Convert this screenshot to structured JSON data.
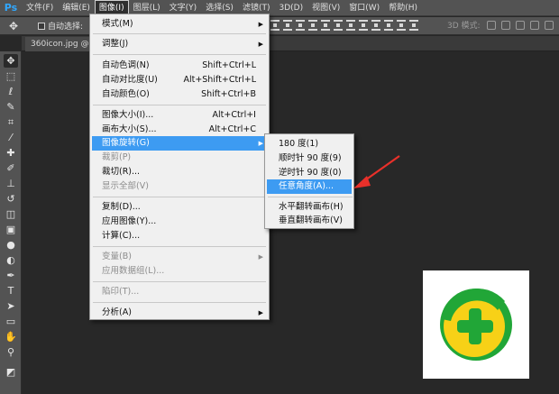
{
  "app": {
    "logo": "Ps"
  },
  "menubar": {
    "items": [
      {
        "label": "文件(F)"
      },
      {
        "label": "编辑(E)"
      },
      {
        "label": "图像(I)"
      },
      {
        "label": "图层(L)"
      },
      {
        "label": "文字(Y)"
      },
      {
        "label": "选择(S)"
      },
      {
        "label": "滤镜(T)"
      },
      {
        "label": "3D(D)"
      },
      {
        "label": "视图(V)"
      },
      {
        "label": "窗口(W)"
      },
      {
        "label": "帮助(H)"
      }
    ],
    "active_index": 2
  },
  "options_bar": {
    "auto_select_label": "自动选择:",
    "mode_3d_label": "3D 模式:"
  },
  "document": {
    "tab_label": "360icon.jpg @ 10"
  },
  "image_menu": {
    "items": [
      {
        "label": "模式(M)",
        "submenu": true
      },
      {
        "label": "调整(J)",
        "submenu": true
      },
      {
        "label": "自动色调(N)",
        "shortcut": "Shift+Ctrl+L"
      },
      {
        "label": "自动对比度(U)",
        "shortcut": "Alt+Shift+Ctrl+L"
      },
      {
        "label": "自动颜色(O)",
        "shortcut": "Shift+Ctrl+B"
      },
      {
        "label": "图像大小(I)...",
        "shortcut": "Alt+Ctrl+I"
      },
      {
        "label": "画布大小(S)...",
        "shortcut": "Alt+Ctrl+C"
      },
      {
        "label": "图像旋转(G)",
        "submenu": true,
        "highlighted": true
      },
      {
        "label": "裁剪(P)",
        "disabled": true
      },
      {
        "label": "裁切(R)..."
      },
      {
        "label": "显示全部(V)",
        "disabled": true
      },
      {
        "label": "复制(D)..."
      },
      {
        "label": "应用图像(Y)..."
      },
      {
        "label": "计算(C)..."
      },
      {
        "label": "变量(B)",
        "submenu": true,
        "disabled": true
      },
      {
        "label": "应用数据组(L)...",
        "disabled": true
      },
      {
        "label": "陷印(T)...",
        "disabled": true
      },
      {
        "label": "分析(A)",
        "submenu": true
      }
    ]
  },
  "rotate_submenu": {
    "items": [
      {
        "label": "180 度(1)"
      },
      {
        "label": "顺时针 90 度(9)"
      },
      {
        "label": "逆时针 90 度(0)"
      },
      {
        "label": "任意角度(A)...",
        "highlighted": true
      },
      {
        "label": "水平翻转画布(H)"
      },
      {
        "label": "垂直翻转画布(V)"
      }
    ]
  },
  "colors": {
    "highlight": "#3d9bf2",
    "annotation_arrow": "#e8302a",
    "icon_yellow": "#f7d117",
    "icon_green": "#21a637"
  },
  "icons": {
    "move_tool": "move-icon",
    "document_icon": "360-icon"
  }
}
